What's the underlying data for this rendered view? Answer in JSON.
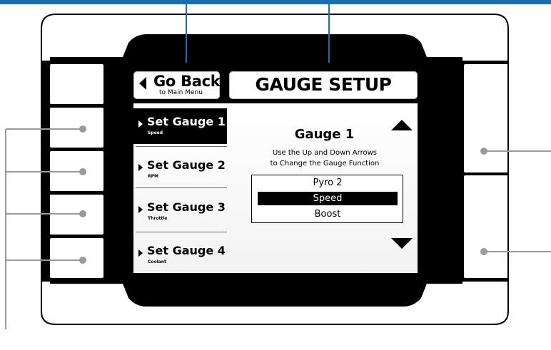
{
  "header": {
    "back_label": "Go Back",
    "back_sublabel": "to Main Menu",
    "title": "GAUGE SETUP"
  },
  "menu": {
    "items": [
      {
        "label": "Set Gauge 1",
        "sublabel": "Speed",
        "active": true
      },
      {
        "label": "Set Gauge 2",
        "sublabel": "RPM",
        "active": false
      },
      {
        "label": "Set Gauge 3",
        "sublabel": "Throttle",
        "active": false
      },
      {
        "label": "Set Gauge 4",
        "sublabel": "Coolant",
        "active": false
      }
    ]
  },
  "detail": {
    "title": "Gauge 1",
    "instruction_line1": "Use the Up and Down Arrows",
    "instruction_line2": "to Change the Gauge Function",
    "options": [
      {
        "label": "Pyro 2",
        "selected": false
      },
      {
        "label": "Speed",
        "selected": true
      },
      {
        "label": "Boost",
        "selected": false
      }
    ]
  },
  "icons": {
    "back": "left-triangle-icon",
    "menu_bullet": "right-triangle-icon",
    "scroll_up": "up-triangle-icon",
    "scroll_down": "down-triangle-icon"
  },
  "colors": {
    "callout_line": "#1a6db3",
    "callout_gray": "#9a9a9a",
    "bezel": "#000000",
    "highlight": "#000000"
  }
}
